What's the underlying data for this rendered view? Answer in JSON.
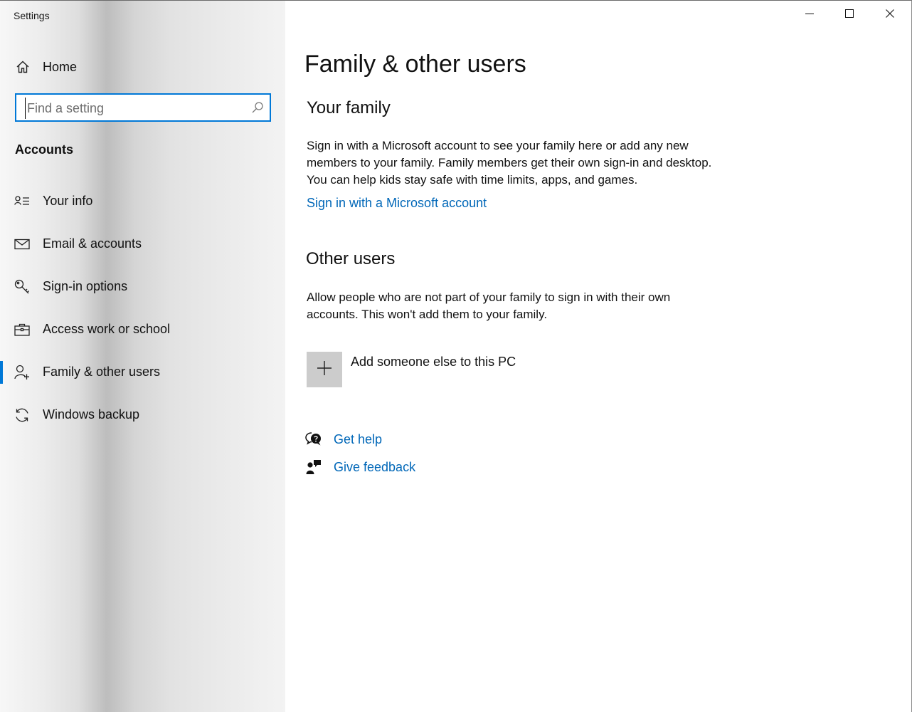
{
  "window": {
    "app_title": "Settings",
    "controls": {
      "minimize_icon": "minimize-icon",
      "maximize_icon": "maximize-icon",
      "close_icon": "close-icon"
    }
  },
  "sidebar": {
    "home": {
      "label": "Home",
      "icon": "home-icon"
    },
    "search": {
      "placeholder": "Find a setting",
      "value": "",
      "icon": "search-icon"
    },
    "section_title": "Accounts",
    "items": [
      {
        "label": "Your info",
        "icon": "contact-card-icon",
        "selected": false
      },
      {
        "label": "Email & accounts",
        "icon": "mail-icon",
        "selected": false
      },
      {
        "label": "Sign-in options",
        "icon": "key-icon",
        "selected": false
      },
      {
        "label": "Access work or school",
        "icon": "briefcase-icon",
        "selected": false
      },
      {
        "label": "Family & other users",
        "icon": "add-person-icon",
        "selected": true
      },
      {
        "label": "Windows backup",
        "icon": "sync-icon",
        "selected": false
      }
    ]
  },
  "main": {
    "page_title": "Family & other users",
    "your_family": {
      "heading": "Your family",
      "description": "Sign in with a Microsoft account to see your family here or add any new members to your family. Family members get their own sign-in and desktop. You can help kids stay safe with time limits, apps, and games.",
      "link": "Sign in with a Microsoft account"
    },
    "other_users": {
      "heading": "Other users",
      "description": "Allow people who are not part of your family to sign in with their own accounts. This won't add them to your family.",
      "add_button_label": "Add someone else to this PC",
      "add_icon": "plus-icon"
    },
    "help": {
      "get_help": "Get help",
      "get_help_icon": "help-chat-icon",
      "give_feedback": "Give feedback",
      "give_feedback_icon": "feedback-icon"
    }
  },
  "colors": {
    "accent": "#0078d7",
    "link": "#0067b8",
    "tile": "#cccccc"
  }
}
